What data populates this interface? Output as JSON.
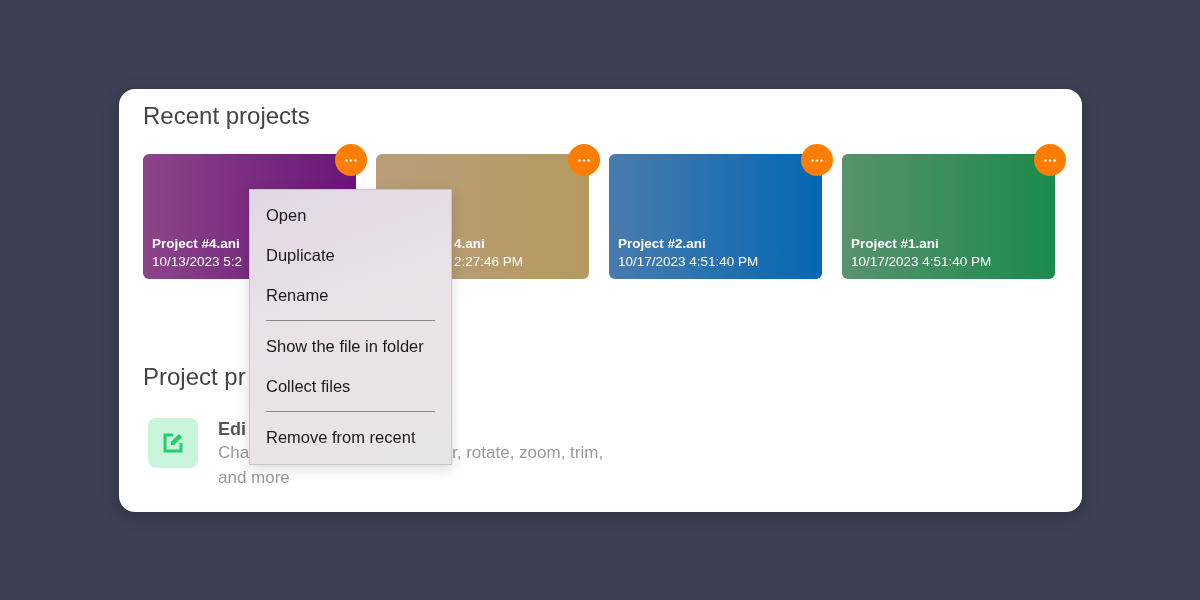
{
  "recent_projects": {
    "title": "Recent projects",
    "projects": [
      {
        "title": "Project #4.ani",
        "modified": "10/13/2023 5:2",
        "color": "#6a1478",
        "kind": "plain"
      },
      {
        "title": "4.ani",
        "modified": "2:27:46 PM",
        "color": "#b49a60",
        "kind": "behind_menu"
      },
      {
        "title": "Project #2.ani",
        "modified": "10/17/2023 4:51:40 PM",
        "color": "#0467b2",
        "kind": "plain"
      },
      {
        "title": "Project #1.ani",
        "modified": "10/17/2023 4:51:40 PM",
        "color": "#1b8a4c",
        "kind": "plain"
      }
    ]
  },
  "project_presets": {
    "title": "Project pr",
    "items": [
      {
        "title": "Edi",
        "description_left": "Cha",
        "description_right": "r, rotate, zoom, trim,",
        "description_more": "and more"
      }
    ]
  },
  "context_menu": {
    "groups": [
      [
        "Open",
        "Duplicate",
        "Rename"
      ],
      [
        "Show the file in folder",
        "Collect files"
      ],
      [
        "Remove from recent"
      ]
    ]
  }
}
